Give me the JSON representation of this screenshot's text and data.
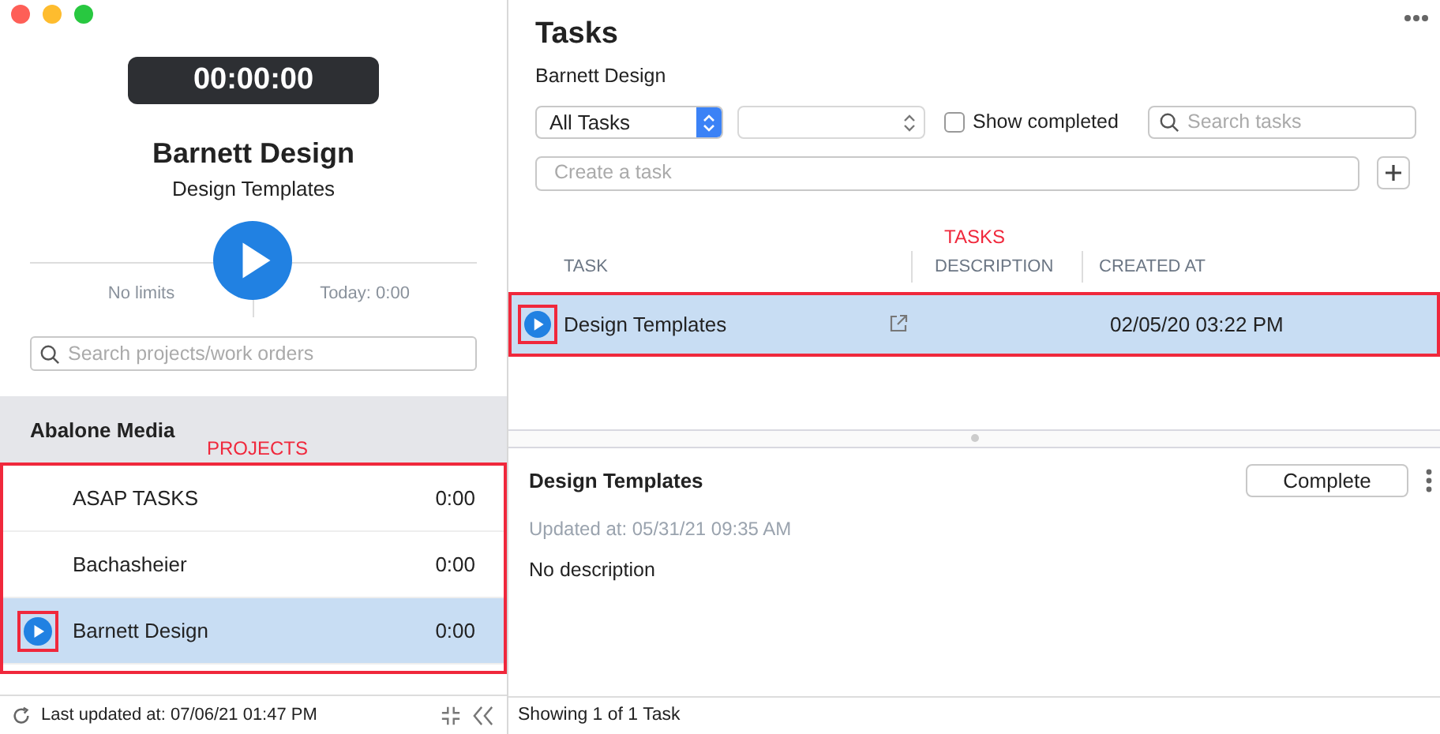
{
  "sidebar": {
    "timer": "00:00:00",
    "project": "Barnett Design",
    "task": "Design Templates",
    "limit": "No limits",
    "today": "Today: 0:00",
    "search": {
      "placeholder": "Search projects/work orders"
    },
    "group": "Abalone Media",
    "annotation": "PROJECTS",
    "projects": [
      {
        "name": "ASAP TASKS",
        "time": "0:00",
        "selected": false
      },
      {
        "name": "Bachasheier",
        "time": "0:00",
        "selected": false
      },
      {
        "name": "Barnett Design",
        "time": "0:00",
        "selected": true
      }
    ],
    "status": "Last updated at: 07/06/21 01:47 PM"
  },
  "main": {
    "title": "Tasks",
    "subtitle": "Barnett Design",
    "filter": "All Tasks",
    "show_completed": {
      "label": "Show completed",
      "checked": false
    },
    "search": {
      "placeholder": "Search tasks"
    },
    "create": {
      "placeholder": "Create a task"
    },
    "annotation": "TASKS",
    "columns": [
      "TASK",
      "DESCRIPTION",
      "CREATED AT"
    ],
    "rows": [
      {
        "task": "Design Templates",
        "created_at": "02/05/20 03:22 PM",
        "selected": true
      }
    ],
    "detail": {
      "title": "Design Templates",
      "button": "Complete",
      "updated": "Updated at: 05/31/21 09:35 AM",
      "description": "No description"
    },
    "status": "Showing 1 of 1 Task"
  }
}
